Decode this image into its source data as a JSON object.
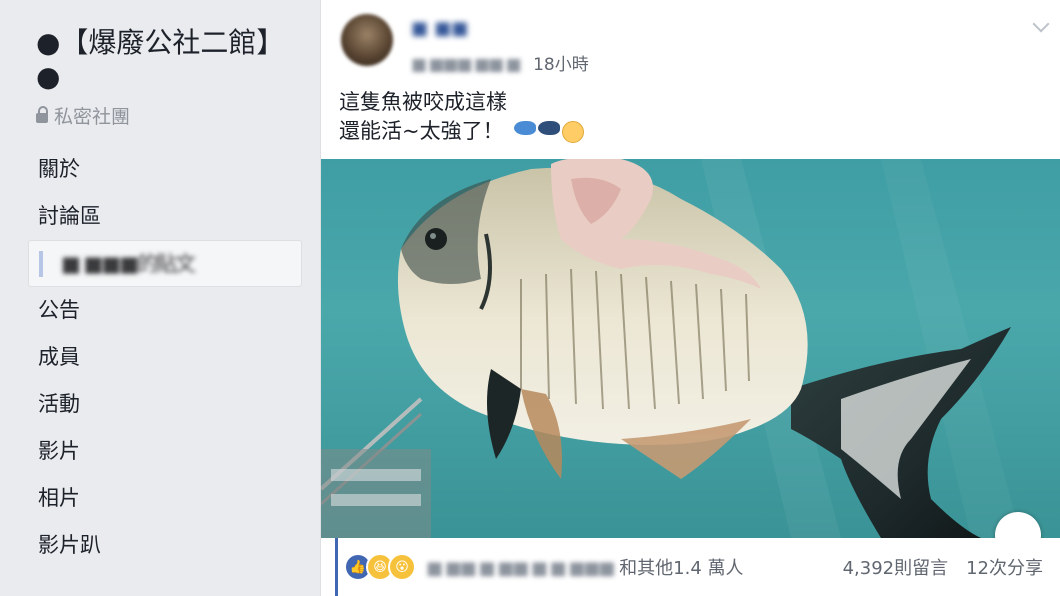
{
  "sidebar": {
    "group_name": "●【爆廢公社二館】●",
    "privacy": "私密社團",
    "items": [
      {
        "label": "關於"
      },
      {
        "label": "討論區"
      },
      {
        "label": "■ ■■■的貼文",
        "active": true
      },
      {
        "label": "公告"
      },
      {
        "label": "成員"
      },
      {
        "label": "活動"
      },
      {
        "label": "影片"
      },
      {
        "label": "相片"
      },
      {
        "label": "影片趴"
      }
    ]
  },
  "post": {
    "author": "■ ■■",
    "meta_blurred": "■ ■■■ ■■ ■",
    "time": "18小時",
    "text_line1": "這隻魚被咬成這樣",
    "text_line2": "還能活~太強了！",
    "icons": [
      "blue-fish-icon",
      "dark-fish-icon",
      "clapping-hands-icon"
    ]
  },
  "reactions": {
    "icons": [
      "like-icon",
      "haha-icon",
      "wow-icon"
    ],
    "names_blurred": "■ ■■ ■ ■■ ■ ■ ■■■",
    "names_suffix": "和其他1.4 萬人",
    "comments": "4,392則留言",
    "shares": "12次分享"
  },
  "colors": {
    "link": "#365899",
    "brand": "#4267b2",
    "water": "#3f9ea4"
  }
}
